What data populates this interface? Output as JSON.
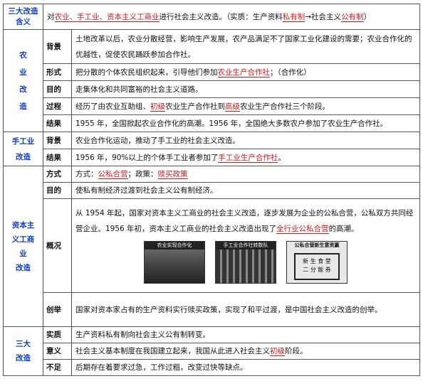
{
  "rows": {
    "r1": {
      "head": "三大改造含义",
      "t1": "对",
      "r1": "农业、手工业、资本主义工商业",
      "t2": "进行社会主义改造。（实质：生产资料",
      "r2": "私有制",
      "t3": "→社会主义",
      "r3": "公有制",
      "t4": "）"
    },
    "agri": {
      "head": "农\n业\n改\n造",
      "bg_label": "背景",
      "bg_text": "土地改革以后，农业分散经营，影响生产发展，农产品满足不了国家工业化建设的需要；农业合作化的优越性，促使农民踊跃参加合作社。",
      "form_label": "形式",
      "form_t1": "把分散的个体农民组织起来，引导他们参加",
      "form_red": "农业生产合作社",
      "form_t2": "；（合作化）",
      "goal_label": "目的",
      "goal_text": "走集体化和共同富裕的社会主义道路。",
      "proc_label": "过程",
      "proc_t1": "经历了由农业互助组、",
      "proc_red1": "初级",
      "proc_t2": "农业生产合作社到",
      "proc_red2": "高级",
      "proc_t3": "农业生产合作社三个阶段。",
      "res_label": "结果",
      "res_text": "1955 年，全国掀起农业合作化的高潮。1956 年，全国绝大多数农户参加了农业生产合作社。"
    },
    "hand": {
      "head": "手工业\n改造",
      "bg_label": "背景",
      "bg_text": "农业合作化运动，推动了手工业的社会主义改造。",
      "res_label": "结果",
      "res_t1": "1956 年，90%以上的个体手工业者参加了",
      "res_red": "手工业生产合作社",
      "res_t2": "。"
    },
    "cap": {
      "head": "资本主\n义工商\n业\n改造",
      "way_label": "方式",
      "way_t1": "方式：",
      "way_red1": "公私合营",
      "way_t2": "；政策：",
      "way_red2": "赎买政策",
      "goal_label": "目的",
      "goal_text": "使私有制经济过渡到社会主义公有制经济。",
      "sum_label": "概况",
      "sum_t1": "从 1954 年起，国家对资本主义工商业的社会主义改造，逐步发展为企业的公私合营，公私双方共同经营企业。1956 年初，资本主义工商业的社会主义改造出现了",
      "sum_red": "全行业公私合营",
      "sum_t2": "的高潮。",
      "img1_caption": "农业实现合作化",
      "img2_caption": "手工业合作社转数队",
      "img3_caption": "公私合营新生意资赢",
      "img3_lines": [
        "新 生 食 堂",
        "二 分 飯 券"
      ],
      "inno_label": "创举",
      "inno_text": "国家对资本家占有的生产资料实行赎买政策，实现了和平过渡，是中国社会主义改造的创举。"
    },
    "three": {
      "head": "三大\n改造",
      "ess_label": "实质",
      "ess_text": "生产资料私有制向社会主义公有制转变。",
      "sig_label": "意义",
      "sig_t1": "社会主义基本制度在我国建立起来，我国从此进入社会主义",
      "sig_red": "初级",
      "sig_t2": "阶段。",
      "lack_label": "不足",
      "lack_text": "后期存在着要求过急，工作过粗，改变过快等缺点。"
    }
  }
}
